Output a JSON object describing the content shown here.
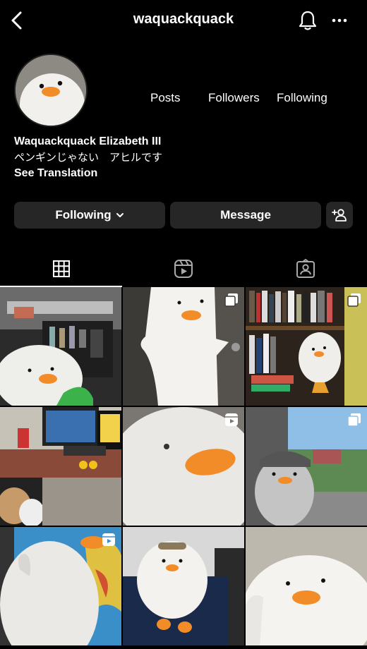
{
  "header": {
    "username": "waquackquack"
  },
  "profile": {
    "stats": {
      "posts_label": "Posts",
      "followers_label": "Followers",
      "following_label": "Following"
    },
    "display_name": "Waquackquack Elizabeth III",
    "bio": "ペンギンじゃない　アヒルです",
    "see_translation": "See Translation"
  },
  "actions": {
    "following_label": "Following",
    "message_label": "Message"
  },
  "tabs": [
    {
      "icon": "grid-icon",
      "active": true
    },
    {
      "icon": "reels-icon",
      "active": false
    },
    {
      "icon": "tagged-icon",
      "active": false
    }
  ],
  "posts": [
    {
      "scene": "duck in bar room",
      "badge": "none"
    },
    {
      "scene": "duck ghost costume",
      "badge": "carousel"
    },
    {
      "scene": "duck by bookshelf",
      "badge": "carousel"
    },
    {
      "scene": "desk with monitors",
      "badge": "none"
    },
    {
      "scene": "duck close-up",
      "badge": "reel"
    },
    {
      "scene": "duck with cap at window",
      "badge": "carousel"
    },
    {
      "scene": "duck waving near map",
      "badge": "reel"
    },
    {
      "scene": "duck lying on bed",
      "badge": "none"
    },
    {
      "scene": "duck portrait",
      "badge": "none"
    }
  ],
  "colors": {
    "background": "#000000",
    "button": "#262626",
    "beak": "#f28c28"
  }
}
